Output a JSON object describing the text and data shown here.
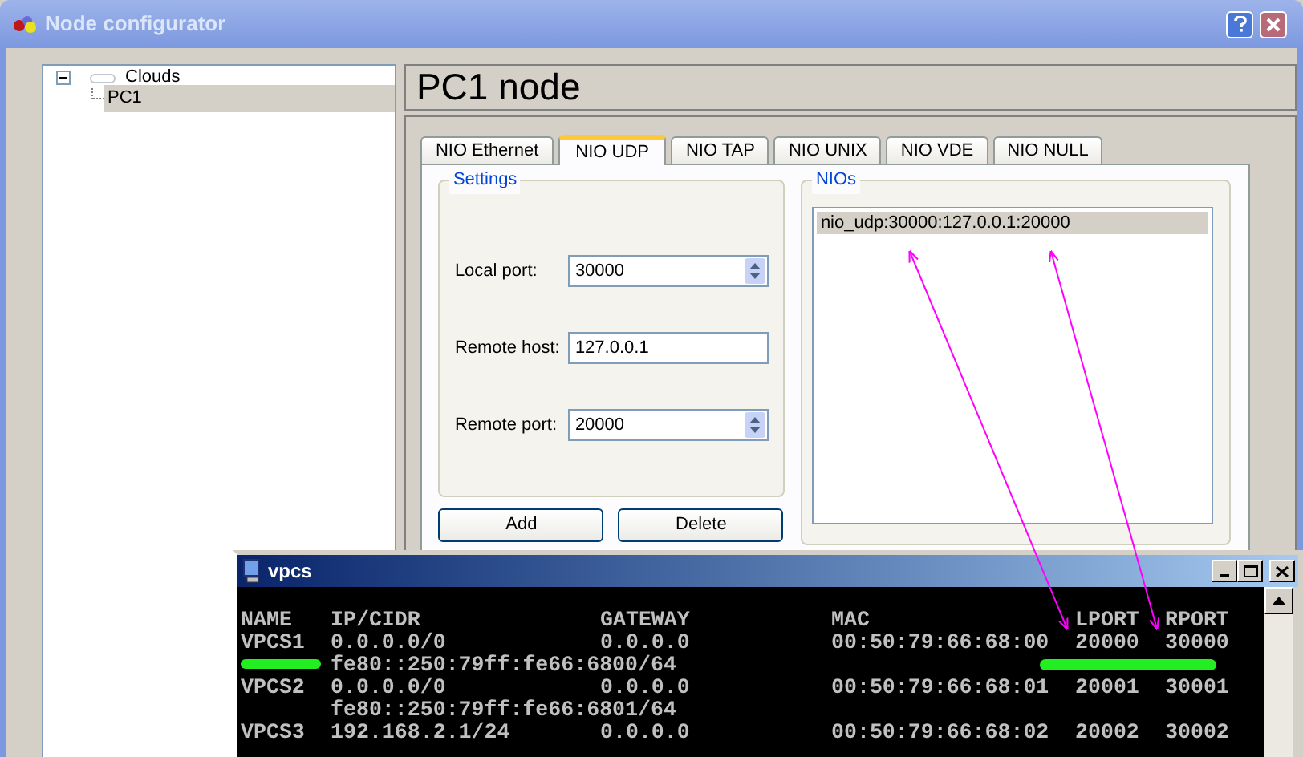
{
  "window": {
    "title": "Node configurator"
  },
  "tree": [
    {
      "label": "Clouds",
      "expanded": true,
      "selected": false,
      "children": [
        {
          "label": "PC1",
          "selected": true
        }
      ]
    }
  ],
  "node_header": "PC1 node",
  "tabs": [
    {
      "label": "NIO Ethernet",
      "selected": false
    },
    {
      "label": "NIO UDP",
      "selected": true
    },
    {
      "label": "NIO TAP",
      "selected": false
    },
    {
      "label": "NIO UNIX",
      "selected": false
    },
    {
      "label": "NIO VDE",
      "selected": false
    },
    {
      "label": "NIO NULL",
      "selected": false
    }
  ],
  "settings": {
    "title": "Settings",
    "fields": [
      {
        "kind": "spin",
        "label": "Local port:",
        "value": "30000"
      },
      {
        "kind": "text",
        "label": "Remote host:",
        "value": "127.0.0.1"
      },
      {
        "kind": "spin",
        "label": "Remote port:",
        "value": "20000"
      }
    ]
  },
  "buttons": [
    "Add",
    "Delete"
  ],
  "nios": {
    "title": "NIOs",
    "items": [
      {
        "label": "nio_udp:30000:127.0.0.1:20000",
        "selected": true
      }
    ]
  },
  "terminal": {
    "title": "vpcs",
    "rows": [
      {
        "name": "NAME",
        "ip": "IP/CIDR",
        "gateway": "GATEWAY",
        "mac": "MAC",
        "lport": "LPORT",
        "rport": "RPORT"
      },
      {
        "name": "VPCS1",
        "ip": "0.0.0.0/0",
        "gateway": "0.0.0.0",
        "mac": "00:50:79:66:68:00",
        "lport": "20000",
        "rport": "30000"
      },
      {
        "ip": "fe80::250:79ff:fe66:6800/64"
      },
      {
        "name": "VPCS2",
        "ip": "0.0.0.0/0",
        "gateway": "0.0.0.0",
        "mac": "00:50:79:66:68:01",
        "lport": "20001",
        "rport": "30001"
      },
      {
        "ip": "fe80::250:79ff:fe66:6801/64"
      },
      {
        "name": "VPCS3",
        "ip": "192.168.2.1/24",
        "gateway": "0.0.0.0",
        "mac": "00:50:79:66:68:02",
        "lport": "20002",
        "rport": "30002"
      }
    ]
  }
}
